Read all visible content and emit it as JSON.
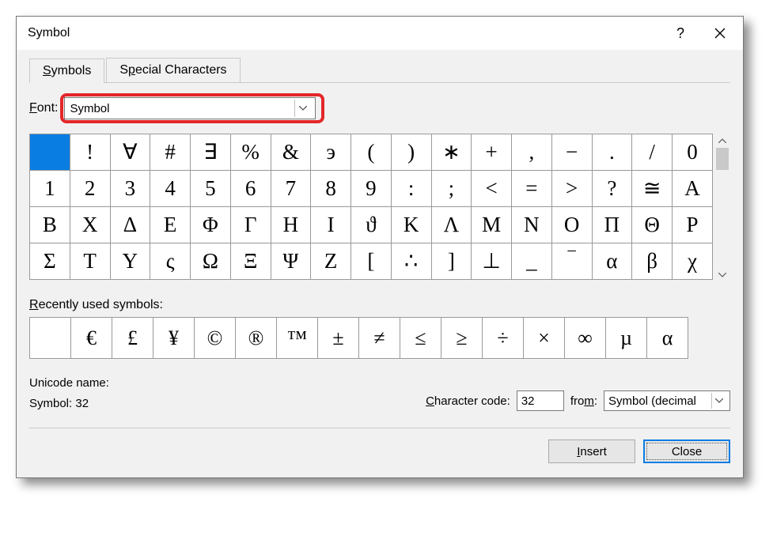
{
  "title": "Symbol",
  "tabs": {
    "symbols": "Symbols",
    "special": "Special Characters"
  },
  "font": {
    "label_pre": "F",
    "label_post": "ont:",
    "value": "Symbol"
  },
  "grid": [
    [
      "",
      "!",
      "∀",
      "#",
      "∃",
      "%",
      "&",
      "э",
      "(",
      ")",
      "∗",
      "+",
      ",",
      "−",
      ".",
      "/",
      "0"
    ],
    [
      "1",
      "2",
      "3",
      "4",
      "5",
      "6",
      "7",
      "8",
      "9",
      ":",
      ";",
      "<",
      "=",
      ">",
      "?",
      "≅",
      "A"
    ],
    [
      "B",
      "X",
      "Δ",
      "E",
      "Φ",
      "Γ",
      "H",
      "I",
      "ϑ",
      "K",
      "Λ",
      "M",
      "N",
      "O",
      "Π",
      "Θ",
      "P"
    ],
    [
      "Σ",
      "T",
      "Y",
      "ς",
      "Ω",
      "Ξ",
      "Ψ",
      "Z",
      "[",
      "∴",
      "]",
      "⊥",
      "_",
      "‾",
      "α",
      "β",
      "χ"
    ]
  ],
  "recent_label_pre": "R",
  "recent_label_post": "ecently used symbols:",
  "recent": [
    "",
    "€",
    "£",
    "¥",
    "©",
    "®",
    "™",
    "±",
    "≠",
    "≤",
    "≥",
    "÷",
    "×",
    "∞",
    "µ",
    "α"
  ],
  "unicode_name_label": "Unicode name:",
  "unicode_name_value": "Symbol: 32",
  "char_code_label_pre": "C",
  "char_code_label_post": "haracter code:",
  "char_code_value": "32",
  "from_label_pre": "fro",
  "from_label_post": ":",
  "from_label_mid": "m",
  "from_value": "Symbol (decimal",
  "buttons": {
    "insert_pre": "I",
    "insert_post": "nsert",
    "close": "Close"
  }
}
